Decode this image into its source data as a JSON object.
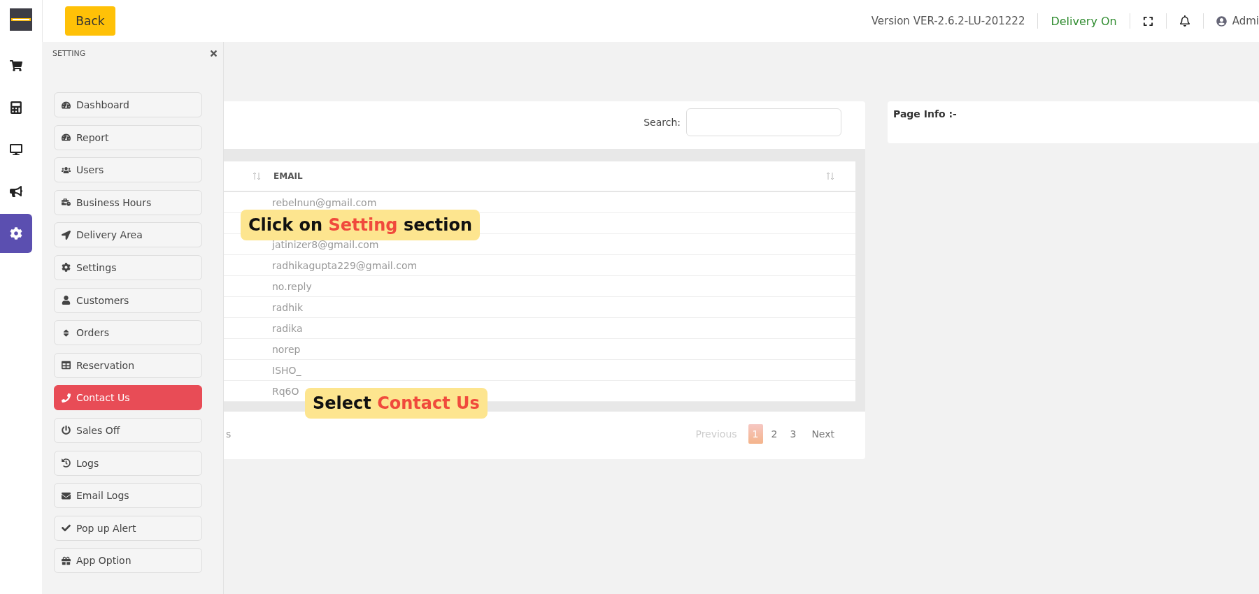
{
  "rail": {
    "items": [
      {
        "selected": false
      },
      {
        "selected": false
      },
      {
        "selected": false
      },
      {
        "selected": false
      },
      {
        "selected": true
      }
    ]
  },
  "header": {
    "back": "Back",
    "version": "Version VER-2.6.2-LU-201222",
    "delivery": "Delivery On",
    "delivery_on": true,
    "user": "Admi"
  },
  "drawer": {
    "title": "SETTING",
    "items": [
      {
        "label": "Dashboard",
        "selected": false
      },
      {
        "label": "Report",
        "selected": false
      },
      {
        "label": "Users",
        "selected": false
      },
      {
        "label": "Business Hours",
        "selected": false
      },
      {
        "label": "Delivery Area",
        "selected": false
      },
      {
        "label": "Settings",
        "selected": false
      },
      {
        "label": "Customers",
        "selected": false
      },
      {
        "label": "Orders",
        "selected": false
      },
      {
        "label": "Reservation",
        "selected": false
      },
      {
        "label": "Contact Us",
        "selected": true
      },
      {
        "label": "Sales Off",
        "selected": false
      },
      {
        "label": "Logs",
        "selected": false
      },
      {
        "label": "Email Logs",
        "selected": false
      },
      {
        "label": "Pop up Alert",
        "selected": false
      },
      {
        "label": "App Option",
        "selected": false
      }
    ]
  },
  "table": {
    "search_label": "Search:",
    "columns": [
      "EMAIL"
    ],
    "rows": [
      {
        "email": "rebelnun@gmail.com"
      },
      {
        "email": null
      },
      {
        "email": "jatinizer8@gmail.com"
      },
      {
        "email": "radhikagupta229@gmail.com"
      },
      {
        "email": "no.reply"
      },
      {
        "email": "radhik"
      },
      {
        "email": "radika"
      },
      {
        "email": "norep"
      },
      {
        "email": "ISHO_"
      },
      {
        "email": "Rq6O"
      }
    ],
    "info": "s",
    "pagination": [
      {
        "label": "Previous",
        "kind": "prev",
        "disabled": true,
        "selected": false
      },
      {
        "label": "1",
        "kind": "page",
        "selected": true
      },
      {
        "label": "2",
        "kind": "page",
        "selected": false
      },
      {
        "label": "3",
        "kind": "page",
        "selected": false
      },
      {
        "label": "Next",
        "kind": "next",
        "disabled": false,
        "selected": false
      }
    ]
  },
  "page_info": {
    "title": "Page Info :-"
  },
  "callouts": [
    {
      "before": "Click on ",
      "highlight": "Setting",
      "after": " section"
    },
    {
      "before": "Select ",
      "highlight": "Contact Us"
    }
  ]
}
